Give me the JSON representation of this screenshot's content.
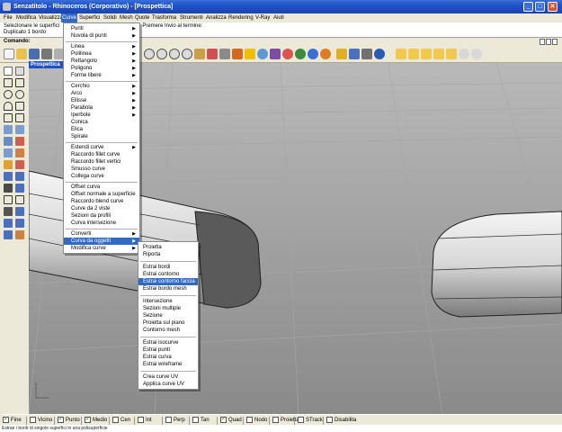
{
  "window": {
    "title": "Senzatitolo - Rhinoceros (Corporativo) - [Prospettica]",
    "buttons": [
      "_",
      "□",
      "✕"
    ]
  },
  "menubar": {
    "items": [
      "File",
      "Modifica",
      "Visualizza",
      "Curve",
      "Superfici",
      "Solidi",
      "Mesh",
      "Quote",
      "Trasforma",
      "Strumenti",
      "Analizza",
      "Rendering",
      "V-Ray",
      "Aiuti"
    ],
    "active": "Curve"
  },
  "command_history": {
    "line1": "Selezionare le superfici",
    "line1_tail": "ti. Premere Invio al termine:",
    "line2": "Duplicato 1 bordo"
  },
  "command_prompt": {
    "label": "Comando:"
  },
  "viewport": {
    "label": "Prospettica"
  },
  "curve_menu": {
    "items": [
      {
        "label": "Punti",
        "sub": true
      },
      {
        "label": "Nuvola di punti",
        "sub": true
      },
      {
        "sep": true
      },
      {
        "label": "Linea",
        "sub": true
      },
      {
        "label": "Polilinea",
        "sub": true
      },
      {
        "label": "Rettangolo",
        "sub": true
      },
      {
        "label": "Poligono",
        "sub": true
      },
      {
        "label": "Forme libere",
        "sub": true
      },
      {
        "sep": true
      },
      {
        "label": "Cerchio",
        "sub": true
      },
      {
        "label": "Arco",
        "sub": true
      },
      {
        "label": "Ellisse",
        "sub": true
      },
      {
        "label": "Parabola",
        "sub": true
      },
      {
        "label": "Iperbole",
        "sub": true
      },
      {
        "label": "Conica",
        "sub": false
      },
      {
        "label": "Elica",
        "sub": false
      },
      {
        "label": "Spirale",
        "sub": false
      },
      {
        "sep": true
      },
      {
        "label": "Estendi curve",
        "sub": true
      },
      {
        "label": "Raccordo fillet curve",
        "sub": false
      },
      {
        "label": "Raccordo fillet vertici",
        "sub": false
      },
      {
        "label": "Smusso curve",
        "sub": false
      },
      {
        "label": "Collega curve",
        "sub": false
      },
      {
        "sep": true
      },
      {
        "label": "Offset curva",
        "sub": false
      },
      {
        "label": "Offset normale a superficie",
        "sub": false
      },
      {
        "label": "Raccordo blend curve",
        "sub": false
      },
      {
        "label": "Curve da 2 viste",
        "sub": false
      },
      {
        "label": "Sezioni da profili",
        "sub": false
      },
      {
        "label": "Curva intersezione",
        "sub": false
      },
      {
        "sep": true
      },
      {
        "label": "Converti",
        "sub": true
      },
      {
        "label": "Curva da oggetti",
        "sub": true,
        "highlight": true
      },
      {
        "label": "Modifica curve",
        "sub": true
      }
    ]
  },
  "object_submenu": {
    "items": [
      {
        "label": "Proietta"
      },
      {
        "label": "Riporta"
      },
      {
        "sep": true
      },
      {
        "label": "Estrai bordi"
      },
      {
        "label": "Estrai contorno"
      },
      {
        "label": "Estrai contorno faccia",
        "highlight": true
      },
      {
        "label": "Estrai bordo mesh"
      },
      {
        "sep": true
      },
      {
        "label": "Intersezione"
      },
      {
        "label": "Sezioni multiple"
      },
      {
        "label": "Sezione"
      },
      {
        "label": "Proietta sul piano"
      },
      {
        "label": "Contorno mesh"
      },
      {
        "sep": true
      },
      {
        "label": "Estrai isocurve"
      },
      {
        "label": "Estrai punti"
      },
      {
        "label": "Estrai curva"
      },
      {
        "label": "Estrai wireframe"
      },
      {
        "sep": true
      },
      {
        "label": "Crea curve UV"
      },
      {
        "label": "Applica curve UV"
      }
    ]
  },
  "osnaps": [
    {
      "label": "Fine",
      "checked": true
    },
    {
      "label": "Vicino",
      "checked": false
    },
    {
      "label": "Punto",
      "checked": true
    },
    {
      "label": "Medio",
      "checked": true
    },
    {
      "label": "Cen",
      "checked": false
    },
    {
      "label": "Int",
      "checked": false
    },
    {
      "label": "Perp",
      "checked": false
    },
    {
      "label": "Tan",
      "checked": false
    },
    {
      "label": "Quad",
      "checked": true
    },
    {
      "label": "Nodo",
      "checked": false
    },
    {
      "label": "Proietta",
      "checked": false
    },
    {
      "label": "STrack",
      "checked": false
    },
    {
      "label": "Disabilita",
      "checked": false
    }
  ],
  "status_line": "Estrae i bordi di singole superfici in una polisuperficie",
  "colors": {
    "accent": "#316ac5",
    "titlebar": "#1f52c8",
    "panel": "#ece9d8",
    "viewport": "#9c9c9c"
  }
}
